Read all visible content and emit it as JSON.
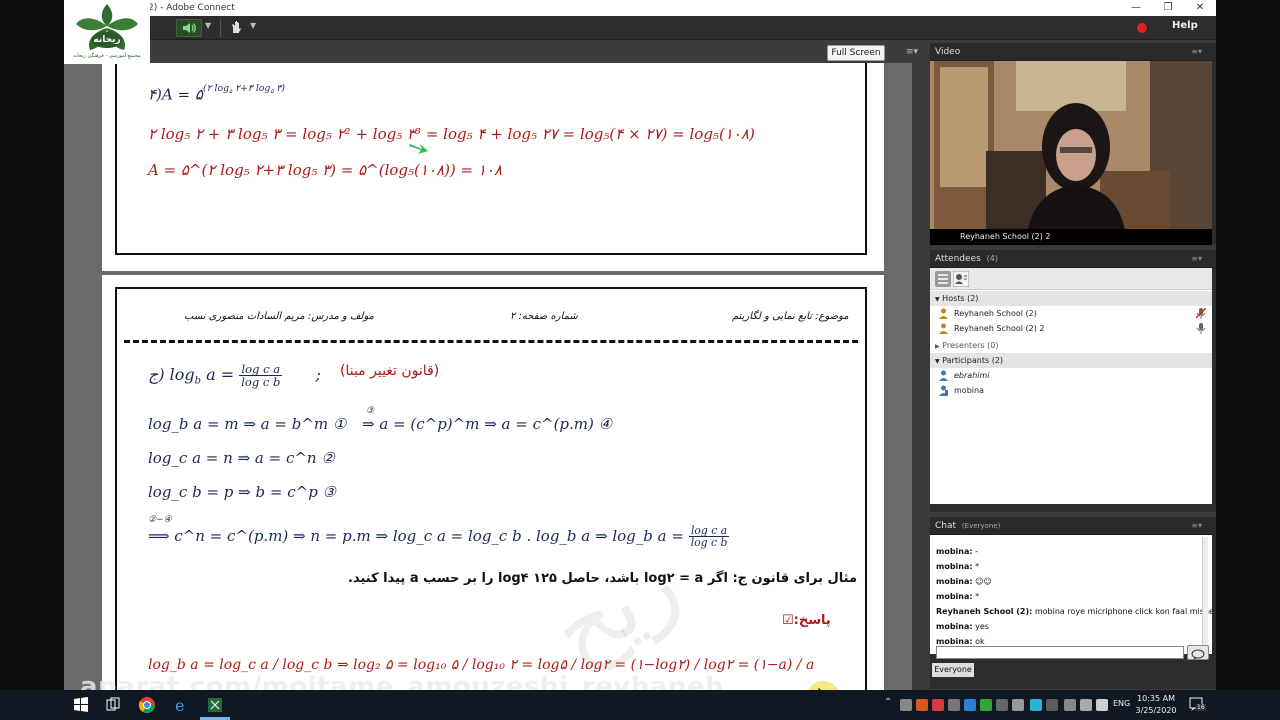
{
  "window": {
    "title": "2) - Adobe Connect",
    "minimize": "—",
    "restore": "❐",
    "close": "✕"
  },
  "toolbar": {
    "help_label": "Help"
  },
  "logo": {
    "emblem_text": "ریحانه",
    "caption": "مجتمع آموزشی - فرهنگی ریحانه"
  },
  "share": {
    "fullscreen_label": "Full Screen",
    "menu_glyph": "≡▾"
  },
  "slide1": {
    "line1": {
      "prefix": "۴)",
      "var": "A",
      "eq": " = ۵",
      "exp": "(۲ log",
      "exp_sub1": "۵",
      "exp_mid": " ۲+۳ log",
      "exp_sub2": "۵",
      "exp_end": " ۳)"
    },
    "line2": "۲ log₅ ۲ + ۳ log₅ ۳ = log₅ ۲² + log₅ ۳³ = log₅ ۴ + log₅ ۲۷ = log₅(۴ × ۲۷) = log₅(۱۰۸)",
    "line3": "A = ۵^(۲ log₅ ۲+۳ log₅ ۳) = ۵^(log₅(۱۰۸)) = ۱۰۸"
  },
  "slide2": {
    "header_right": "موضوع: تابع نمایی و لگاریتم",
    "header_center": "شماره صفحه: ۲",
    "header_left": "مولف و مدرس: مریم السادات منصوری نسب",
    "rule_title": "(قانون تغییر مبنا)",
    "rule_label": "ج)",
    "rule_lhs": "log",
    "rule_lhs_sub": "b",
    "rule_lhs_arg": " a = ",
    "rule_frac_num": "log c a",
    "rule_frac_den": "log c b",
    "rule_sep": ";",
    "eq1": "log_b a = m ⇒ a = b^m  ①",
    "eq1b": "⇒ a = (c^p)^m ⇒ a = c^(p.m)  ④",
    "eq1b_over": "③",
    "eq2": "log_c a = n ⇒ a = c^n  ②",
    "eq3": "log_c b = p ⇒ b = c^p  ③",
    "eq4_over": "②−④",
    "eq4": "⟹ c^n = c^(p.m) ⇒ n = p.m ⇒ log_c a = log_c b . log_b a ⇒ log_b a =",
    "eq4_frac_num": "log c a",
    "eq4_frac_den": "log c b",
    "example": "مثال برای قانون ج: اگر log۲ = a باشد، حاصل log۴ ۱۲۵ را بر حسب a پیدا کنید.",
    "answer_label": "پاسخ:☑",
    "answer_eq": "log_b a = log_c a / log_c b ⇒ log₂ ۵ = log₁₀ ۵ / log₁₀ ۲ = log۵ / log۲ = (۱−log۲) / log۲ = (۱−a) / a"
  },
  "video": {
    "title": "Video",
    "caption": "Reyhaneh School (2) 2"
  },
  "attendees": {
    "title": "Attendees",
    "count": "(4)",
    "hosts_label": "Hosts (2)",
    "hosts": [
      "Reyhaneh School (2)",
      "Reyhaneh School (2) 2"
    ],
    "presenters_label": "Presenters (0)",
    "participants_label": "Participants (2)",
    "participants": [
      "ebrahimi",
      "mobina"
    ]
  },
  "chat": {
    "title": "Chat",
    "scope": "(Everyone)",
    "messages": [
      {
        "who": "mobina:",
        "text": " -"
      },
      {
        "who": "mobina:",
        "text": " *"
      },
      {
        "who": "mobina:",
        "text": " ☺☺"
      },
      {
        "who": "mobina:",
        "text": " *"
      },
      {
        "who": "Reyhaneh School (2):",
        "text": " mobina roye micriphone click kon faal mishe"
      },
      {
        "who": "mobina:",
        "text": " yes"
      },
      {
        "who": "mobina:",
        "text": " ok"
      }
    ],
    "tab_label": "Everyone"
  },
  "taskbar": {
    "lang": "ENG",
    "time": "10:35 AM",
    "date": "3/25/2020",
    "notif_count": "16"
  },
  "watermark": "aparat.com/mojtame_amouzeshi_reyhaneh",
  "colors": {
    "math_red": "#b01818",
    "math_dark": "#1b2a52",
    "record_red": "#e02020"
  }
}
